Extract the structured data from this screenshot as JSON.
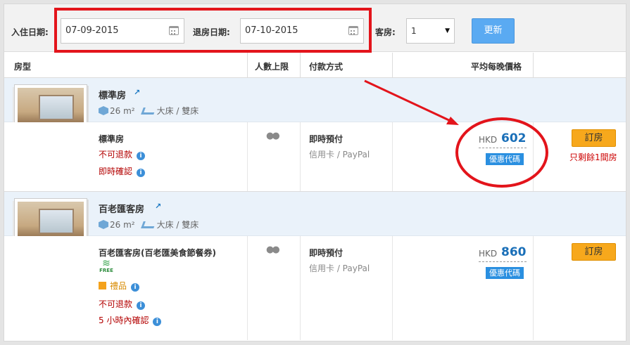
{
  "search": {
    "checkin_label": "入住日期:",
    "checkin_value": "07-09-2015",
    "checkout_label": "退房日期:",
    "checkout_value": "07-10-2015",
    "rooms_label": "客房:",
    "rooms_value": "1",
    "update_label": "更新"
  },
  "table_header": {
    "room_type": "房型",
    "max_people": "人數上限",
    "payment": "付款方式",
    "avg_price": "平均每晚價格"
  },
  "rooms": [
    {
      "title": "標準房",
      "size": "26 m²",
      "bed": "大床 / 雙床",
      "rate_name": "標準房",
      "policy1": "不可退款",
      "policy2": "即時確認",
      "payment": "即時預付",
      "payment_methods": "信用卡 / PayPal",
      "currency": "HKD",
      "price": "602",
      "promo": "優惠代碼",
      "book": "訂房",
      "availability": "只剩餘1間房"
    },
    {
      "title": "百老匯客房",
      "size": "26 m²",
      "bed": "大床 / 雙床",
      "rate_name": "百老匯客房(百老匯美食節餐券)",
      "wifi_free": "FREE",
      "gift": "禮品",
      "policy1": "不可退款",
      "policy2": "5 小時內確認",
      "payment": "即時預付",
      "payment_methods": "信用卡 / PayPal",
      "currency": "HKD",
      "price": "860",
      "promo": "優惠代碼",
      "book": "訂房"
    }
  ],
  "colors": {
    "accent_blue": "#1a6fb8",
    "promo_blue": "#2a8fe0",
    "book_orange": "#f7a81c",
    "annotation_red": "#e3141b"
  }
}
